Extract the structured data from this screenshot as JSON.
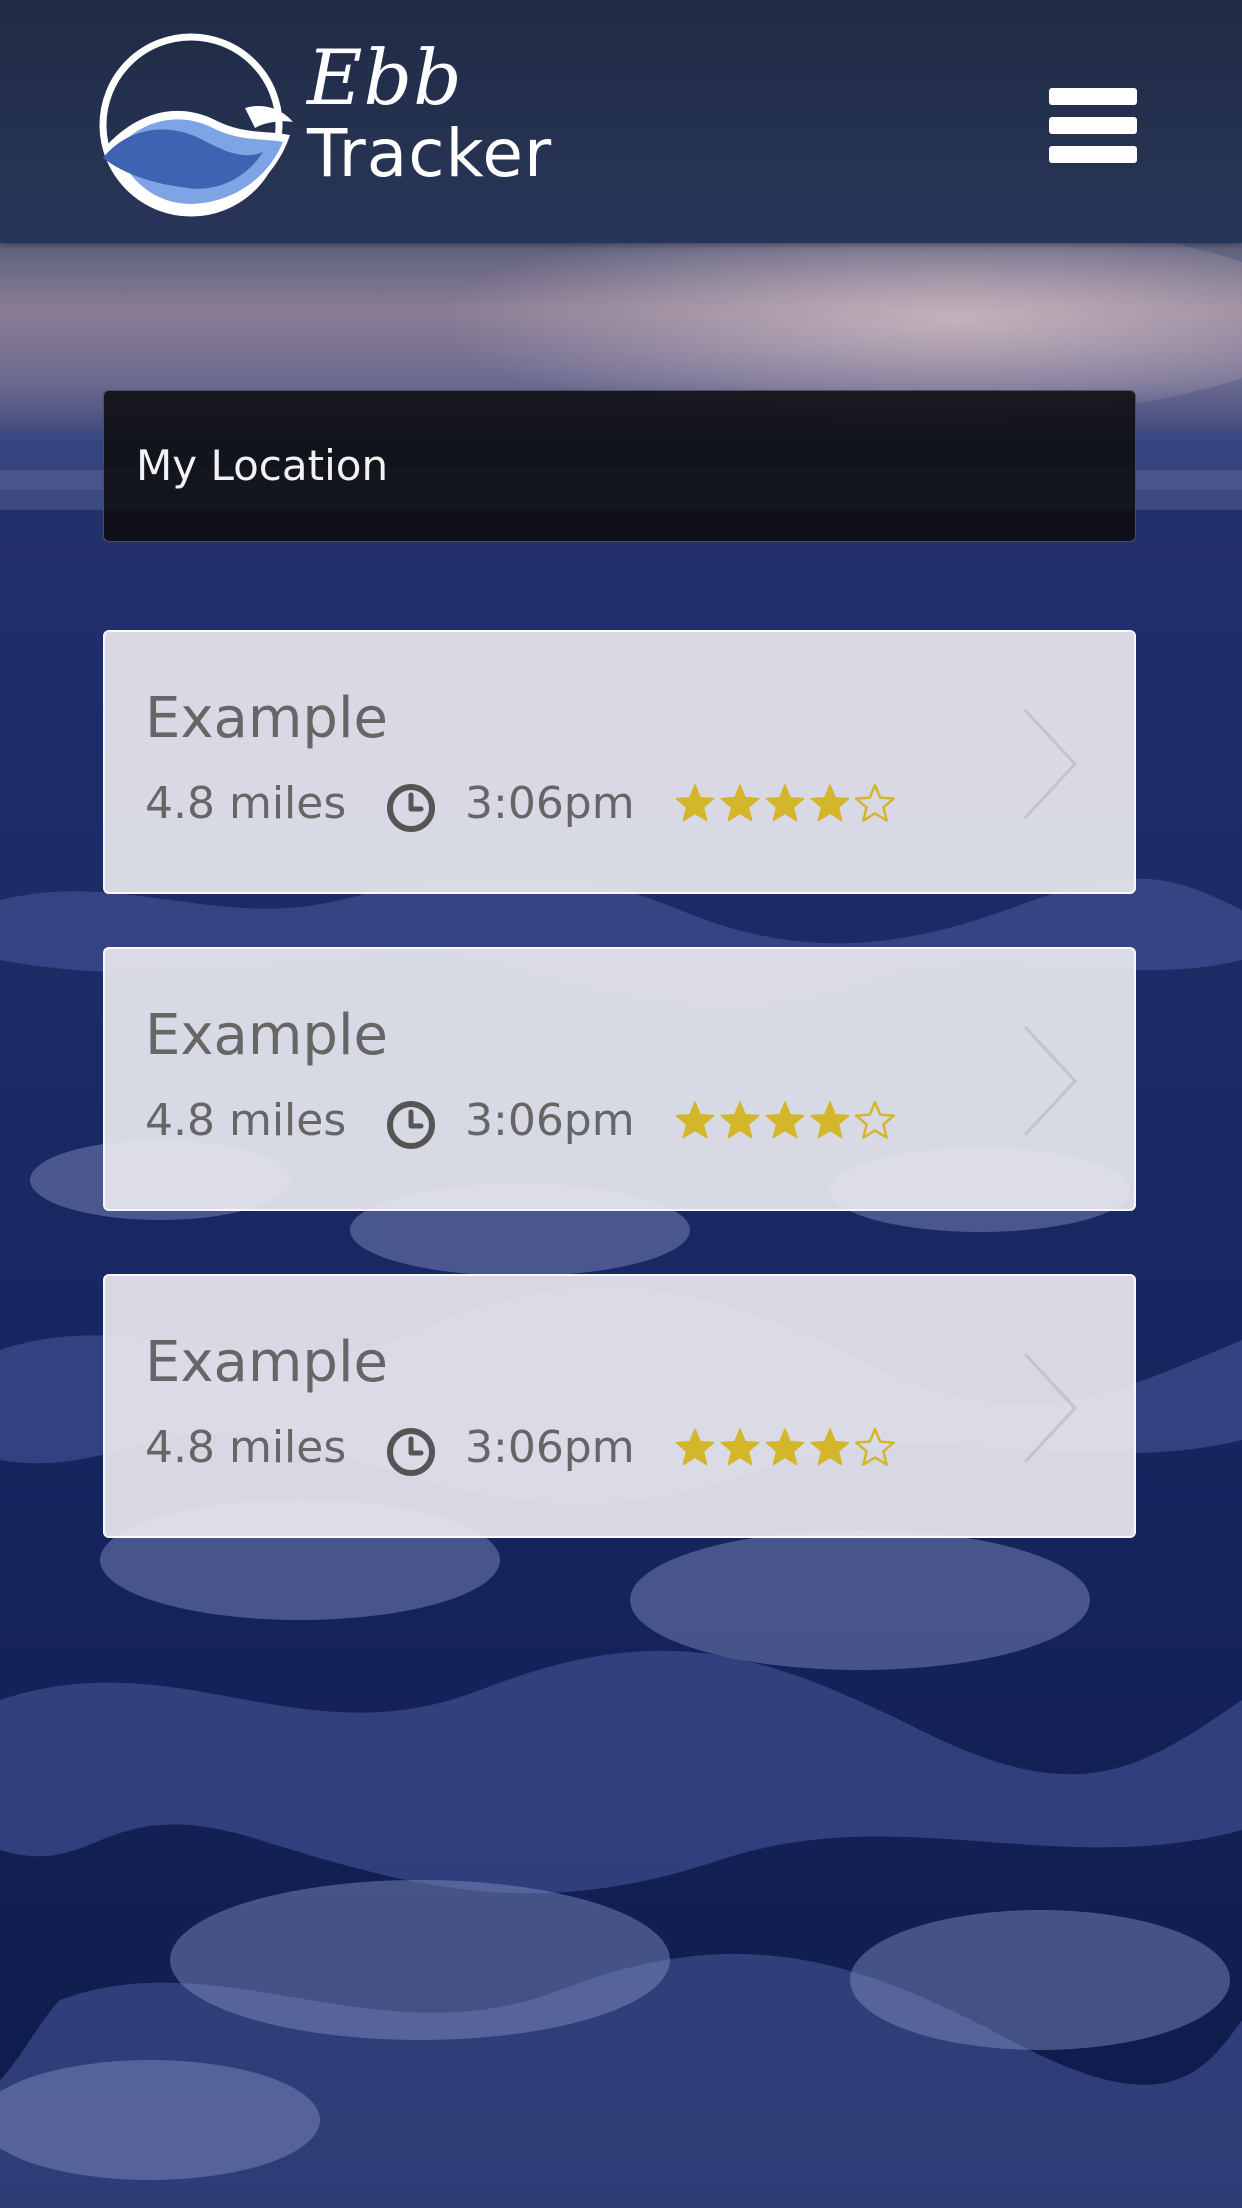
{
  "app": {
    "logo_script": "Ebb",
    "logo_word": "Tracker"
  },
  "icons": {
    "logo": "wave-circle-logo-icon",
    "menu": "hamburger-menu-icon",
    "clock": "clock-icon",
    "star": "star-icon",
    "chevron": "chevron-right-icon"
  },
  "colors": {
    "header_bg": "#25324f",
    "logo_blue": "#3f63b3",
    "logo_light_blue": "#7fa4e6",
    "star_filled": "#d4b62b",
    "card_text": "#666666",
    "location_text": "#f2f2f2"
  },
  "location": {
    "text": "My Location"
  },
  "locations": [
    {
      "title": "Example",
      "distance": "4.8 miles",
      "time": "3:06pm",
      "rating": 4,
      "max_rating": 5
    },
    {
      "title": "Example",
      "distance": "4.8 miles",
      "time": "3:06pm",
      "rating": 4,
      "max_rating": 5
    },
    {
      "title": "Example",
      "distance": "4.8 miles",
      "time": "3:06pm",
      "rating": 4,
      "max_rating": 5
    }
  ]
}
